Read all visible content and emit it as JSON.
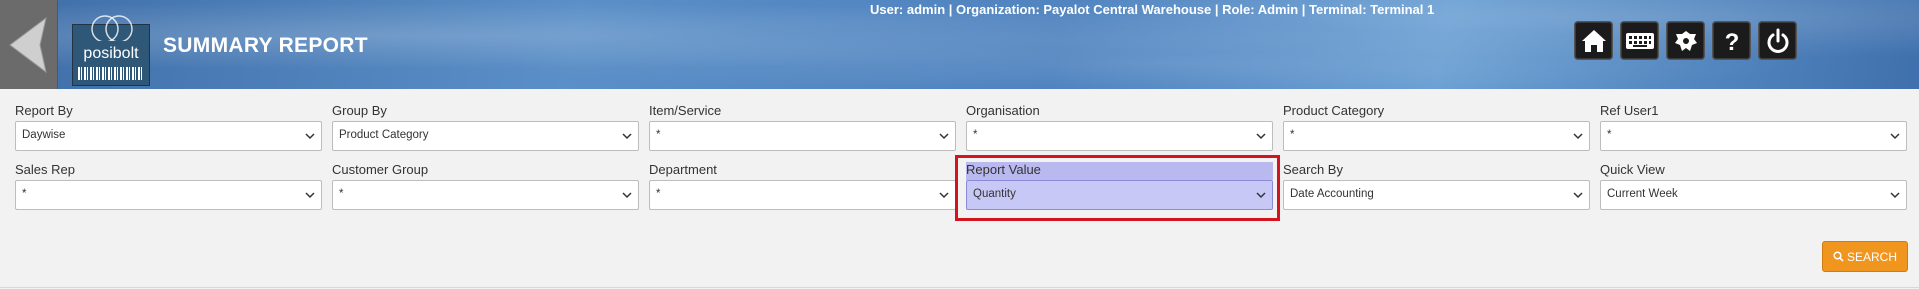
{
  "header": {
    "title": "SUMMARY REPORT",
    "logo_text": "posibolt",
    "user_info": "User: admin | Organization: Payalot Central Warehouse | Role: Admin | Terminal: Terminal 1",
    "icons": [
      "home-icon",
      "keyboard-icon",
      "settings-icon",
      "help-icon",
      "power-icon"
    ]
  },
  "form": {
    "fields": [
      {
        "label": "Report By",
        "value": "Daywise"
      },
      {
        "label": "Group By",
        "value": "Product Category"
      },
      {
        "label": "Item/Service",
        "value": "*"
      },
      {
        "label": "Organisation",
        "value": "*"
      },
      {
        "label": "Product Category",
        "value": "*"
      },
      {
        "label": "Ref User1",
        "value": "*"
      },
      {
        "label": "Sales Rep",
        "value": "*"
      },
      {
        "label": "Customer Group",
        "value": "*"
      },
      {
        "label": "Department",
        "value": "*"
      },
      {
        "label": "Report Value",
        "value": "Quantity"
      },
      {
        "label": "Search By",
        "value": "Date Accounting"
      },
      {
        "label": "Quick View",
        "value": "Current Week"
      }
    ]
  },
  "search_button": {
    "label": "SEARCH"
  },
  "colors": {
    "accent": "#f0961e",
    "highlight": "#d2141f",
    "selected": "#c8c8f7"
  }
}
